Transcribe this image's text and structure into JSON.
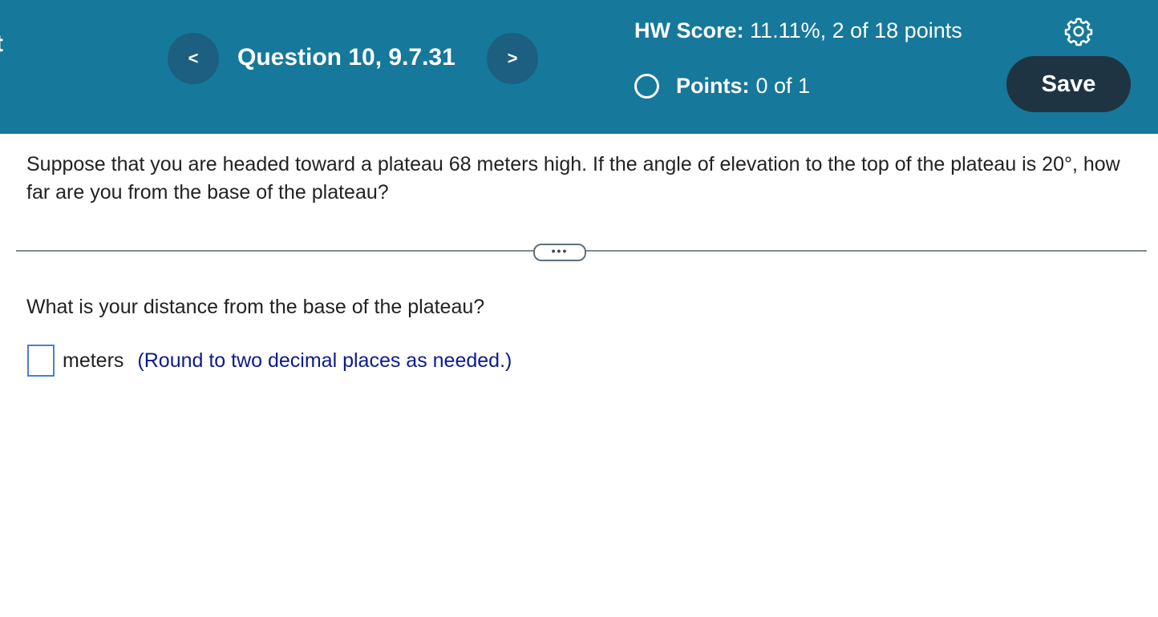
{
  "edge_text": "t",
  "header": {
    "prev_icon": "chevron-left-icon",
    "prev_glyph": "<",
    "question_title": "Question 10, 9.7.31",
    "next_icon": "chevron-right-icon",
    "next_glyph": ">",
    "hw_score_label": "HW Score:",
    "hw_score_value": "11.11%, 2 of 18 points",
    "points_label": "Points:",
    "points_value": "0 of 1",
    "settings_icon": "gear-icon",
    "save_label": "Save"
  },
  "problem": {
    "statement": "Suppose that you are headed toward a plateau 68 meters high.  If the angle of elevation to the top of the plateau is 20°, how far are you from the base of the plateau?",
    "more_label": "•••",
    "sub_question": "What is your distance from the base of the plateau?",
    "answer_value": "",
    "unit": "meters",
    "hint": "(Round to two decimal places as needed.)"
  },
  "colors": {
    "header_bg": "#16789b",
    "nav_button_bg": "#1c5f80",
    "save_button_bg": "#1f3443",
    "hint_text": "#0d1a8c",
    "answer_border": "#4a7fd1"
  }
}
